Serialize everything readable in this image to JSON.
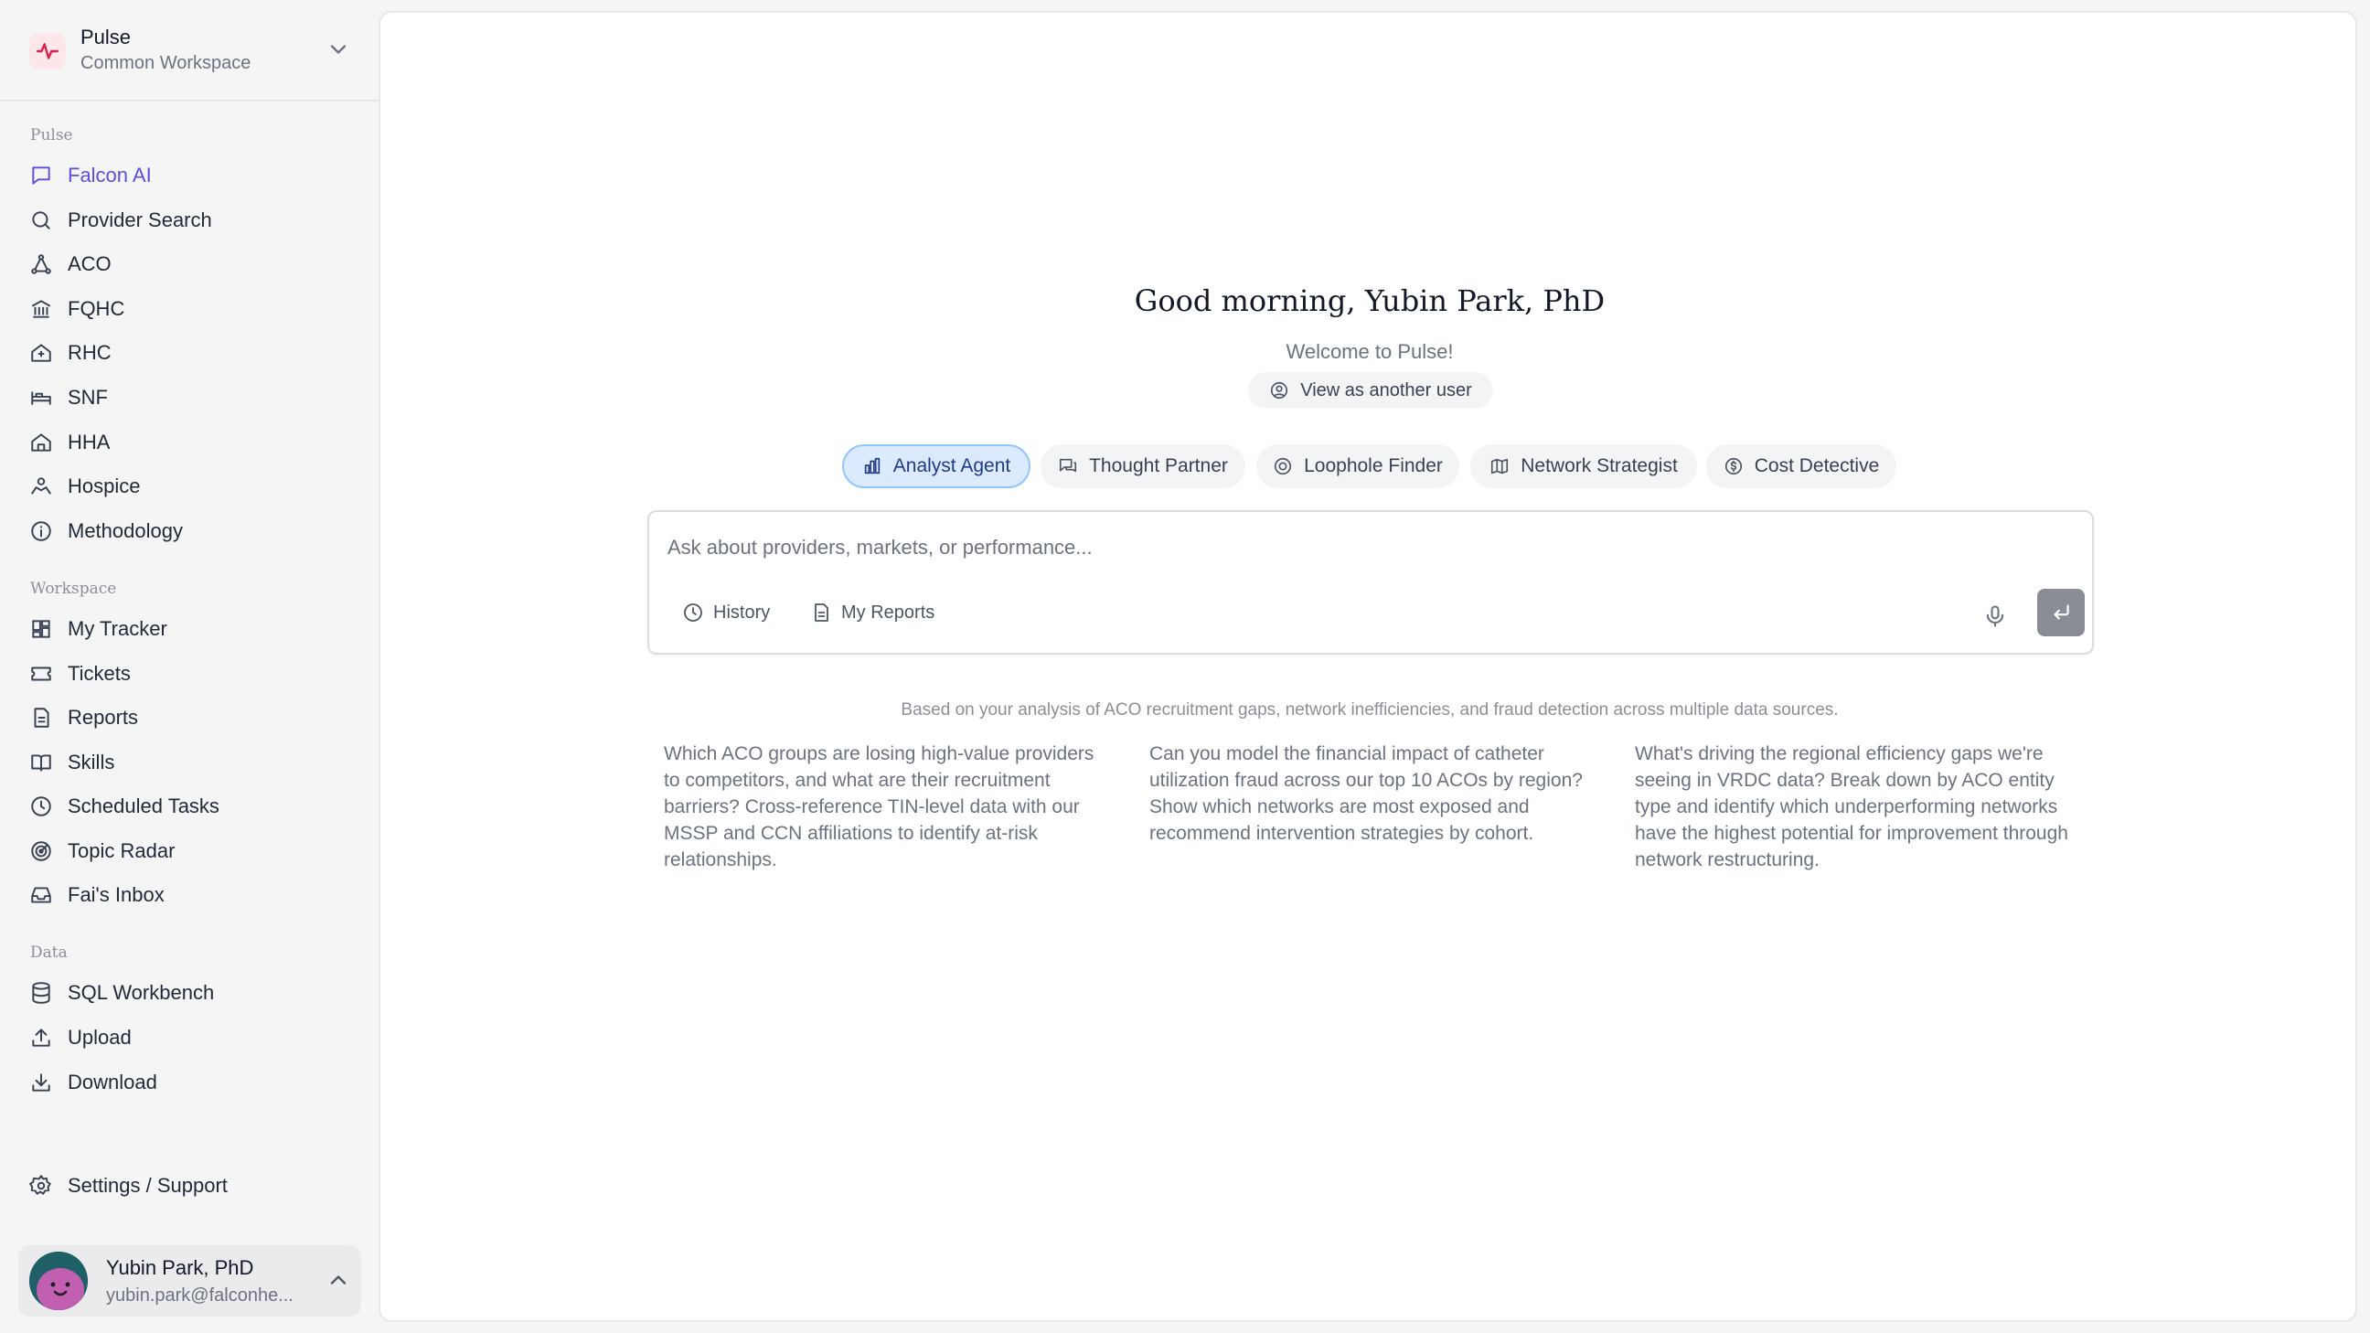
{
  "workspace": {
    "name": "Pulse",
    "subtitle": "Common Workspace"
  },
  "sidebar": {
    "sections": {
      "pulse": "Pulse",
      "workspace": "Workspace",
      "data": "Data"
    },
    "pulse_items": [
      {
        "label": "Falcon AI",
        "icon": "chat-icon",
        "active": true
      },
      {
        "label": "Provider Search",
        "icon": "search-icon"
      },
      {
        "label": "ACO",
        "icon": "network-icon"
      },
      {
        "label": "FQHC",
        "icon": "building-icon"
      },
      {
        "label": "RHC",
        "icon": "house-plus-icon"
      },
      {
        "label": "SNF",
        "icon": "bed-icon"
      },
      {
        "label": "HHA",
        "icon": "home-icon"
      },
      {
        "label": "Hospice",
        "icon": "hands-icon"
      },
      {
        "label": "Methodology",
        "icon": "info-icon"
      }
    ],
    "workspace_items": [
      {
        "label": "My Tracker",
        "icon": "dashboard-icon"
      },
      {
        "label": "Tickets",
        "icon": "ticket-icon"
      },
      {
        "label": "Reports",
        "icon": "document-icon"
      },
      {
        "label": "Skills",
        "icon": "book-icon"
      },
      {
        "label": "Scheduled Tasks",
        "icon": "clock-icon"
      },
      {
        "label": "Topic Radar",
        "icon": "radar-icon"
      },
      {
        "label": "Fai's Inbox",
        "icon": "inbox-icon"
      }
    ],
    "data_items": [
      {
        "label": "SQL Workbench",
        "icon": "database-icon"
      },
      {
        "label": "Upload",
        "icon": "upload-icon"
      },
      {
        "label": "Download",
        "icon": "download-icon"
      }
    ],
    "settings": "Settings / Support"
  },
  "user": {
    "name": "Yubin Park, PhD",
    "email": "yubin.park@falconhe..."
  },
  "main": {
    "greeting": "Good morning, Yubin Park, PhD",
    "welcome": "Welcome to Pulse!",
    "view_as": "View as another user",
    "modes": [
      "Analyst Agent",
      "Thought Partner",
      "Loophole Finder",
      "Network Strategist",
      "Cost Detective"
    ],
    "active_mode": "Analyst Agent",
    "composer": {
      "placeholder": "Ask about providers, markets, or performance...",
      "value": "",
      "history": "History",
      "reports": "My Reports"
    },
    "based_on": "Based on your analysis of ACO recruitment gaps, network inefficiencies, and fraud detection across multiple data sources.",
    "suggestions": [
      "Which ACO groups are losing high-value providers to competitors, and what are their recruitment barriers? Cross-reference TIN-level data with our MSSP and CCN affiliations to identify at-risk relationships.",
      "Can you model the financial impact of catheter utilization fraud across our top 10 ACOs by region? Show which networks are most exposed and recommend intervention strategies by cohort.",
      "What's driving the regional efficiency gaps we're seeing in VRDC data? Break down by ACO entity type and identify which underperforming networks have the highest potential for improvement through network restructuring."
    ]
  },
  "colors": {
    "accent": "#5b4fe0",
    "brand": "#e11d48",
    "active_tab_bg": "#dbeafe"
  }
}
